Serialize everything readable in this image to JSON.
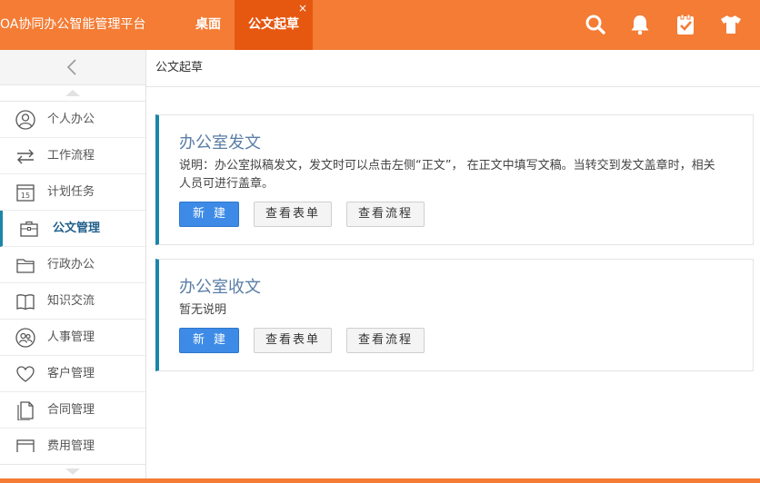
{
  "header": {
    "app_title": "OA协同办公智能管理平台",
    "tabs": [
      {
        "label": "桌面",
        "active": false
      },
      {
        "label": "公文起草",
        "active": true,
        "close": "×"
      }
    ],
    "icons": [
      "search-icon",
      "bell-icon",
      "clipboard-check-icon",
      "tshirt-icon"
    ],
    "accent_color": "#f47c35",
    "active_tab_color": "#e65710"
  },
  "sidebar": {
    "items": [
      {
        "label": "个人办公",
        "icon": "person-icon"
      },
      {
        "label": "工作流程",
        "icon": "swap-arrows-icon"
      },
      {
        "label": "计划任务",
        "icon": "calendar-icon",
        "icon_text": "15"
      },
      {
        "label": "公文管理",
        "icon": "briefcase-icon",
        "active": true
      },
      {
        "label": "行政办公",
        "icon": "folder-icon"
      },
      {
        "label": "知识交流",
        "icon": "book-icon"
      },
      {
        "label": "人事管理",
        "icon": "people-icon"
      },
      {
        "label": "客户管理",
        "icon": "heart-icon"
      },
      {
        "label": "合同管理",
        "icon": "document-icon"
      },
      {
        "label": "费用管理",
        "icon": "money-icon"
      }
    ],
    "active_color": "#1c85a8"
  },
  "breadcrumb": "公文起草",
  "cards": [
    {
      "title": "办公室发文",
      "description": "说明：办公室拟稿发文，发文时可以点击左侧“正文”， 在正文中填写文稿。当转交到发文盖章时，相关人员可进行盖章。",
      "buttons": {
        "new": "新建",
        "view_form": "查看表单",
        "view_flow": "查看流程"
      }
    },
    {
      "title": "办公室收文",
      "description": "暂无说明",
      "buttons": {
        "new": "新建",
        "view_form": "查看表单",
        "view_flow": "查看流程"
      }
    }
  ]
}
